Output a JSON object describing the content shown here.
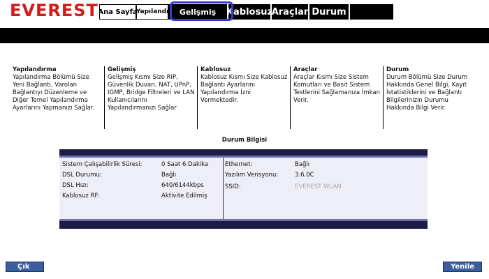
{
  "brand": {
    "logo_text": "EVEREST",
    "logo_color": "#d21a1a"
  },
  "tabs": [
    {
      "label": "Ana Sayfa",
      "active": true
    },
    {
      "label": "Yapılandı"
    },
    {
      "label": "Gelişmiş",
      "highlighted": true
    },
    {
      "label": "Kablosuz"
    },
    {
      "label": "Araçlar"
    },
    {
      "label": "Durum"
    }
  ],
  "columns": [
    {
      "title": "Yapılandırma",
      "text": "Yapılandırma Bölümü Size Yeni Bağlantı, Varolan Bağlantıyı Düzenleme ve Diğer Temel Yapılandırma Ayarlarını Yapmanızı Sağlar."
    },
    {
      "title": "Gelişmiş",
      "text": "Gelişmiş Kısmı Size RIP, Güvenlik Duvarı, NAT, UPnP, IGMP, Bridge Filtreleri ve LAN Kullanıcılarını Yapılandırmanızı Sağlar"
    },
    {
      "title": "Kablosuz",
      "text": "Kablosuz Kısmı Size Kablosuz Bağlantı Ayarlarını Yapılandırma İzni Vermektedir."
    },
    {
      "title": "Araçlar",
      "text": "Araçlar Kısmı Size Sistem Komutları ve Basit Sistem Testlerini Sağlamanıza İmkan Verir."
    },
    {
      "title": "Durum",
      "text": "Durum Bölümü Size Durum Hakkında Genel Bilgi, Kayıt İstatistiklerini ve Bağlantı Bilgilerinizin Durumu Hakkında Bilgi Verir."
    }
  ],
  "status": {
    "title": "Durum Bilgisi",
    "left": [
      {
        "label": "Sistem Çalışabilirlik Süresi:",
        "value": "0 Saat 6 Dakika"
      },
      {
        "label": "DSL Durumu:",
        "value": "Bağlı"
      },
      {
        "label": "DSL Hızı:",
        "value": "640/6144kbps"
      },
      {
        "label": "Kablosuz RF:",
        "value": "Aktivite Edilmiş"
      }
    ],
    "right": [
      {
        "label": "Ethernet:",
        "value": "Bağlı"
      },
      {
        "label": "Yazılım Verisyonu:",
        "value": "3.6.0C"
      },
      {
        "label": "SSID:",
        "value": "EVEREST WLAN"
      }
    ]
  },
  "buttons": {
    "exit": "Çık",
    "refresh": "Yenile"
  }
}
